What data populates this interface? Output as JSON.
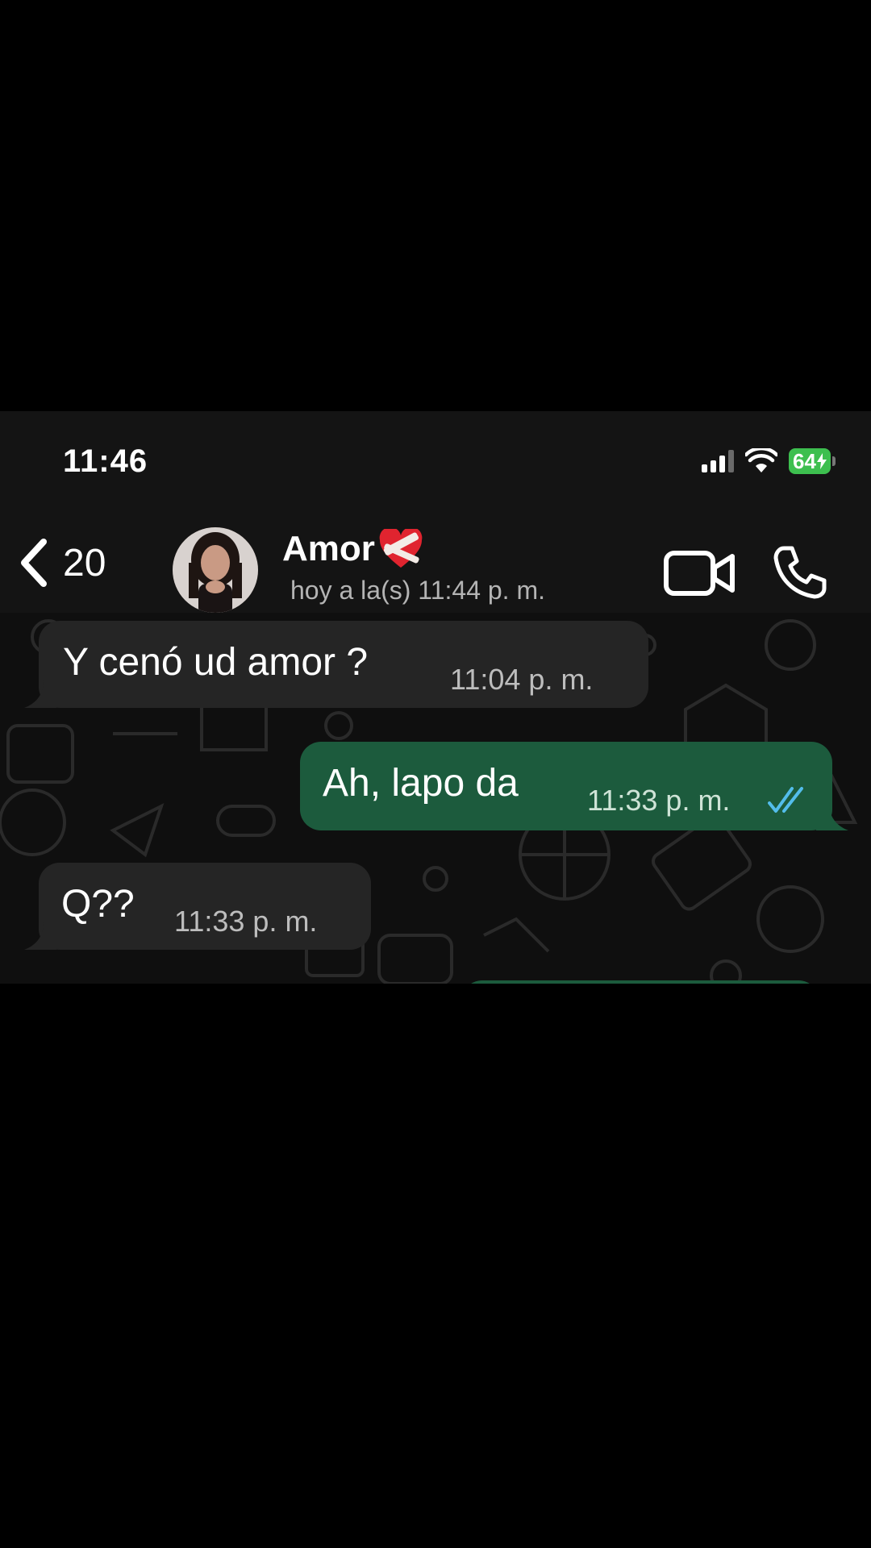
{
  "status_bar": {
    "time": "11:46",
    "battery_level": "64",
    "icons": [
      "signal-icon",
      "wifi-icon",
      "battery-charging-icon"
    ]
  },
  "header": {
    "back_count": "20",
    "contact_name": "Amor",
    "contact_emoji": "heart-bandaged-icon",
    "last_seen": "hoy a la(s) 11:44 p. m.",
    "actions": [
      "video-call-icon",
      "voice-call-icon"
    ]
  },
  "messages": [
    {
      "direction": "incoming",
      "text": "Y cenó ud amor ?",
      "time": "11:04 p. m."
    },
    {
      "direction": "outgoing",
      "text": "Ah, lapo da",
      "time": "11:33 p. m.",
      "status": "read"
    },
    {
      "direction": "incoming",
      "text": "Q??",
      "time": "11:33 p. m."
    }
  ],
  "colors": {
    "incoming_bubble": "#252525",
    "outgoing_bubble": "#1c5b3d",
    "read_ticks": "#53bdeb",
    "battery": "#3dbf4f"
  }
}
